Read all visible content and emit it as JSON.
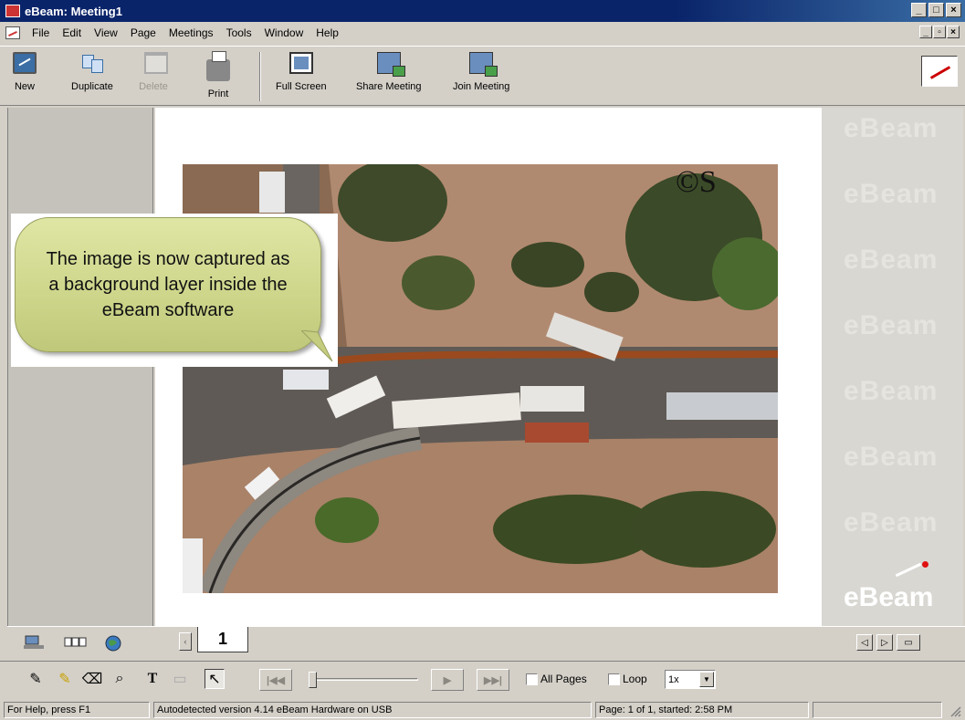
{
  "window": {
    "title": "eBeam: Meeting1"
  },
  "menu": [
    "File",
    "Edit",
    "View",
    "Page",
    "Meetings",
    "Tools",
    "Window",
    "Help"
  ],
  "toolbar": {
    "new": "New",
    "duplicate": "Duplicate",
    "delete": "Delete",
    "print": "Print",
    "full_screen": "Full Screen",
    "share_meeting": "Share Meeting",
    "join_meeting": "Join Meeting"
  },
  "callout": {
    "text": "The image is now captured as a background layer inside the eBeam software"
  },
  "photo": {
    "watermark": "©S"
  },
  "brand": {
    "watermark": "eBeam",
    "logo": "eBeam"
  },
  "pagebar": {
    "current_page": "1"
  },
  "playback": {
    "all_pages_label": "All Pages",
    "loop_label": "Loop",
    "speed_value": "1x"
  },
  "status": {
    "help": "For Help, press F1",
    "hardware": "Autodetected version 4.14 eBeam Hardware on USB",
    "page": "Page: 1 of 1, started: 2:58 PM"
  },
  "colors": {
    "title_bar": "#0a246a",
    "callout_fill": "#cdd58a",
    "logo_dot": "#e01010"
  }
}
